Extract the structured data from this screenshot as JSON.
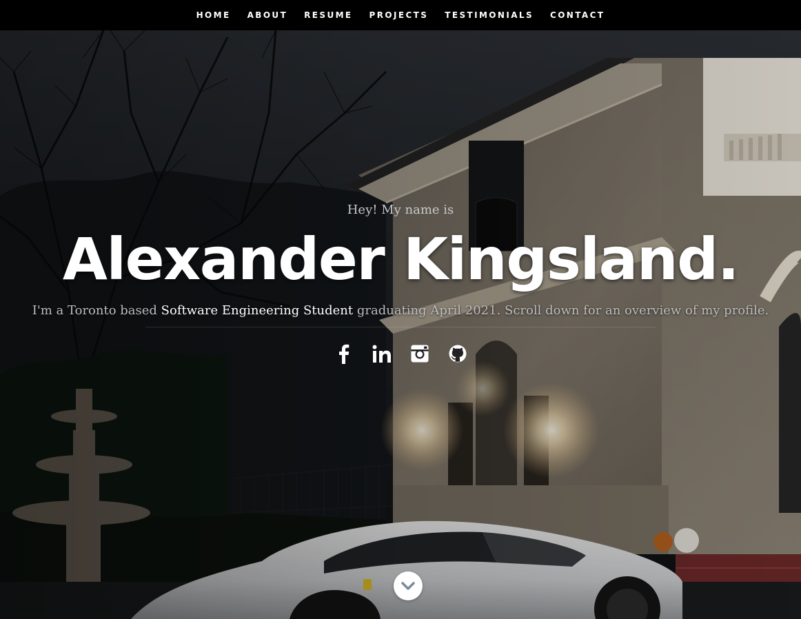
{
  "nav": {
    "items": [
      "HOME",
      "ABOUT",
      "RESUME",
      "PROJECTS",
      "TESTIMONIALS",
      "CONTACT"
    ]
  },
  "hero": {
    "greeting": "Hey! My name is",
    "name": "Alexander Kingsland.",
    "intro_prefix": "I'm a Toronto based ",
    "intro_highlight": "Software Engineering Student",
    "intro_suffix": " graduating April 2021. Scroll down for an overview of my profile."
  },
  "social": [
    "facebook-icon",
    "linkedin-icon",
    "instagram-icon",
    "github-icon"
  ],
  "scroll_icon": "chevron-down-icon",
  "colors": {
    "nav_bg": "#000000",
    "headline": "#ffffff",
    "muted_text": "#bdbdbd",
    "scroll_button": "#ffffff",
    "scroll_chevron": "#7a8a99"
  }
}
